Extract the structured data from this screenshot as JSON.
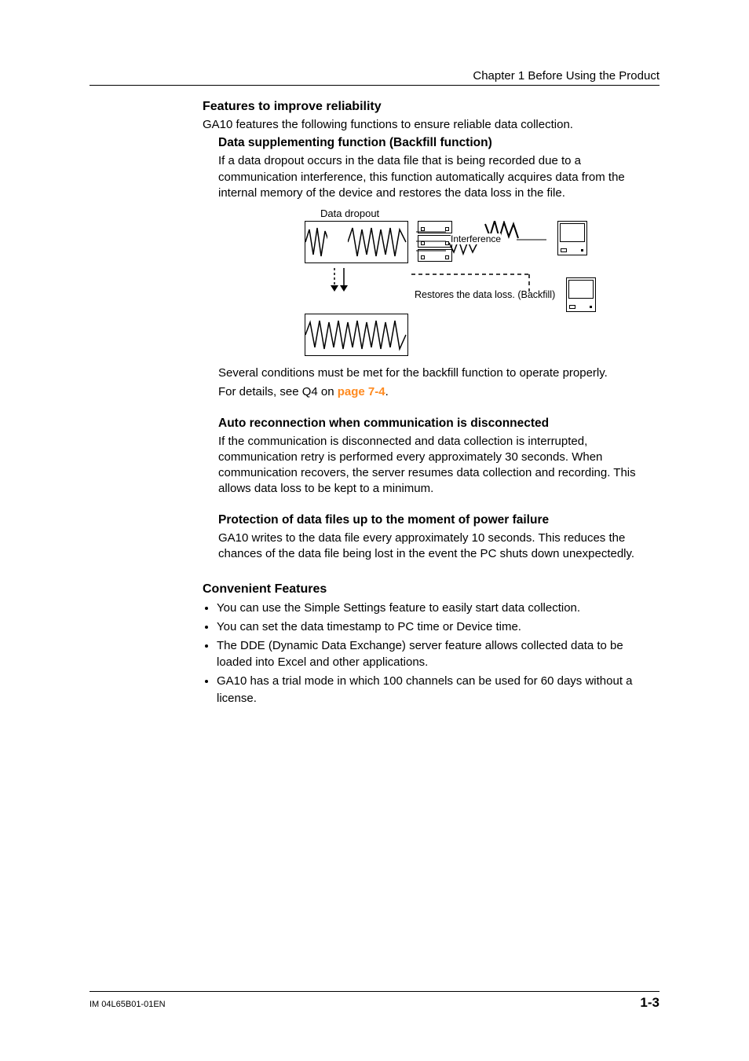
{
  "header": {
    "chapter_line": "Chapter 1  Before Using the Product"
  },
  "section1": {
    "heading": "Features to improve reliability",
    "intro": "GA10 features the following functions to ensure reliable data collection.",
    "sub1": {
      "heading": "Data supplementing function (Backfill function)",
      "para1": "If a data dropout occurs in the data file that is being recorded due to a communication interference, this function automatically acquires data from the internal memory of the device and restores the data loss in the file."
    },
    "diagram": {
      "label_top": "Data dropout",
      "interference": "Interference",
      "restore": "Restores the data loss. (Backfill)"
    },
    "after_diagram_p1": "Several conditions must be met for the backfill function to operate properly.",
    "after_diagram_p2_prefix": "For details, see Q4 on ",
    "after_diagram_link": "page 7-4",
    "after_diagram_p2_suffix": ".",
    "sub2": {
      "heading": "Auto reconnection when communication is disconnected",
      "para": "If the communication is disconnected and data collection is interrupted, communication retry is performed every approximately 30 seconds. When communication recovers, the server resumes data collection and recording. This allows data loss to be kept to a minimum."
    },
    "sub3": {
      "heading": "Protection of data files up to the moment of power failure",
      "para": "GA10 writes to the data file every approximately 10 seconds. This reduces the chances of the data file being lost in the event the PC shuts down unexpectedly."
    }
  },
  "section2": {
    "heading": "Convenient Features",
    "bullets": [
      "You can use the Simple Settings feature to easily start data collection.",
      "You can set the data timestamp to PC time or Device time.",
      "The DDE (Dynamic Data Exchange) server feature allows collected data to be loaded into Excel and other applications.",
      "GA10 has a trial mode in which 100 channels can be used for 60 days without a license."
    ]
  },
  "footer": {
    "left": "IM 04L65B01-01EN",
    "right": "1-3"
  }
}
